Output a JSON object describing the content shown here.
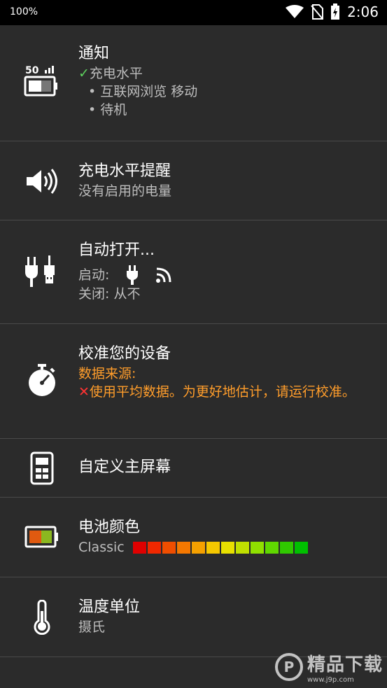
{
  "status": {
    "battery": "100%",
    "time": "2:06"
  },
  "items": [
    {
      "title": "通知",
      "check": "✓",
      "lines": [
        "充电水平",
        "• 互联网浏览 移动",
        "• 待机"
      ]
    },
    {
      "title": "充电水平提醒",
      "sub": "没有启用的电量"
    },
    {
      "title": "自动打开...",
      "start_label": "启动:",
      "close_label": "关闭: 从不"
    },
    {
      "title": "校准您的设备",
      "source_label": "数据来源:",
      "cross": "✕",
      "source_text": "使用平均数据。为更好地估计，请运行校准。"
    },
    {
      "title": "自定义主屏幕"
    },
    {
      "title": "电池颜色",
      "sub": "Classic"
    },
    {
      "title": "温度单位",
      "sub": "摄氏"
    }
  ],
  "palette": [
    "#e00000",
    "#f02800",
    "#f04e00",
    "#f57800",
    "#f5a000",
    "#f5c800",
    "#e8e000",
    "#c0e000",
    "#90e000",
    "#60d800",
    "#30c800",
    "#00c000"
  ],
  "watermark": {
    "brand": "精品下载",
    "site": "www.j9p.com"
  }
}
